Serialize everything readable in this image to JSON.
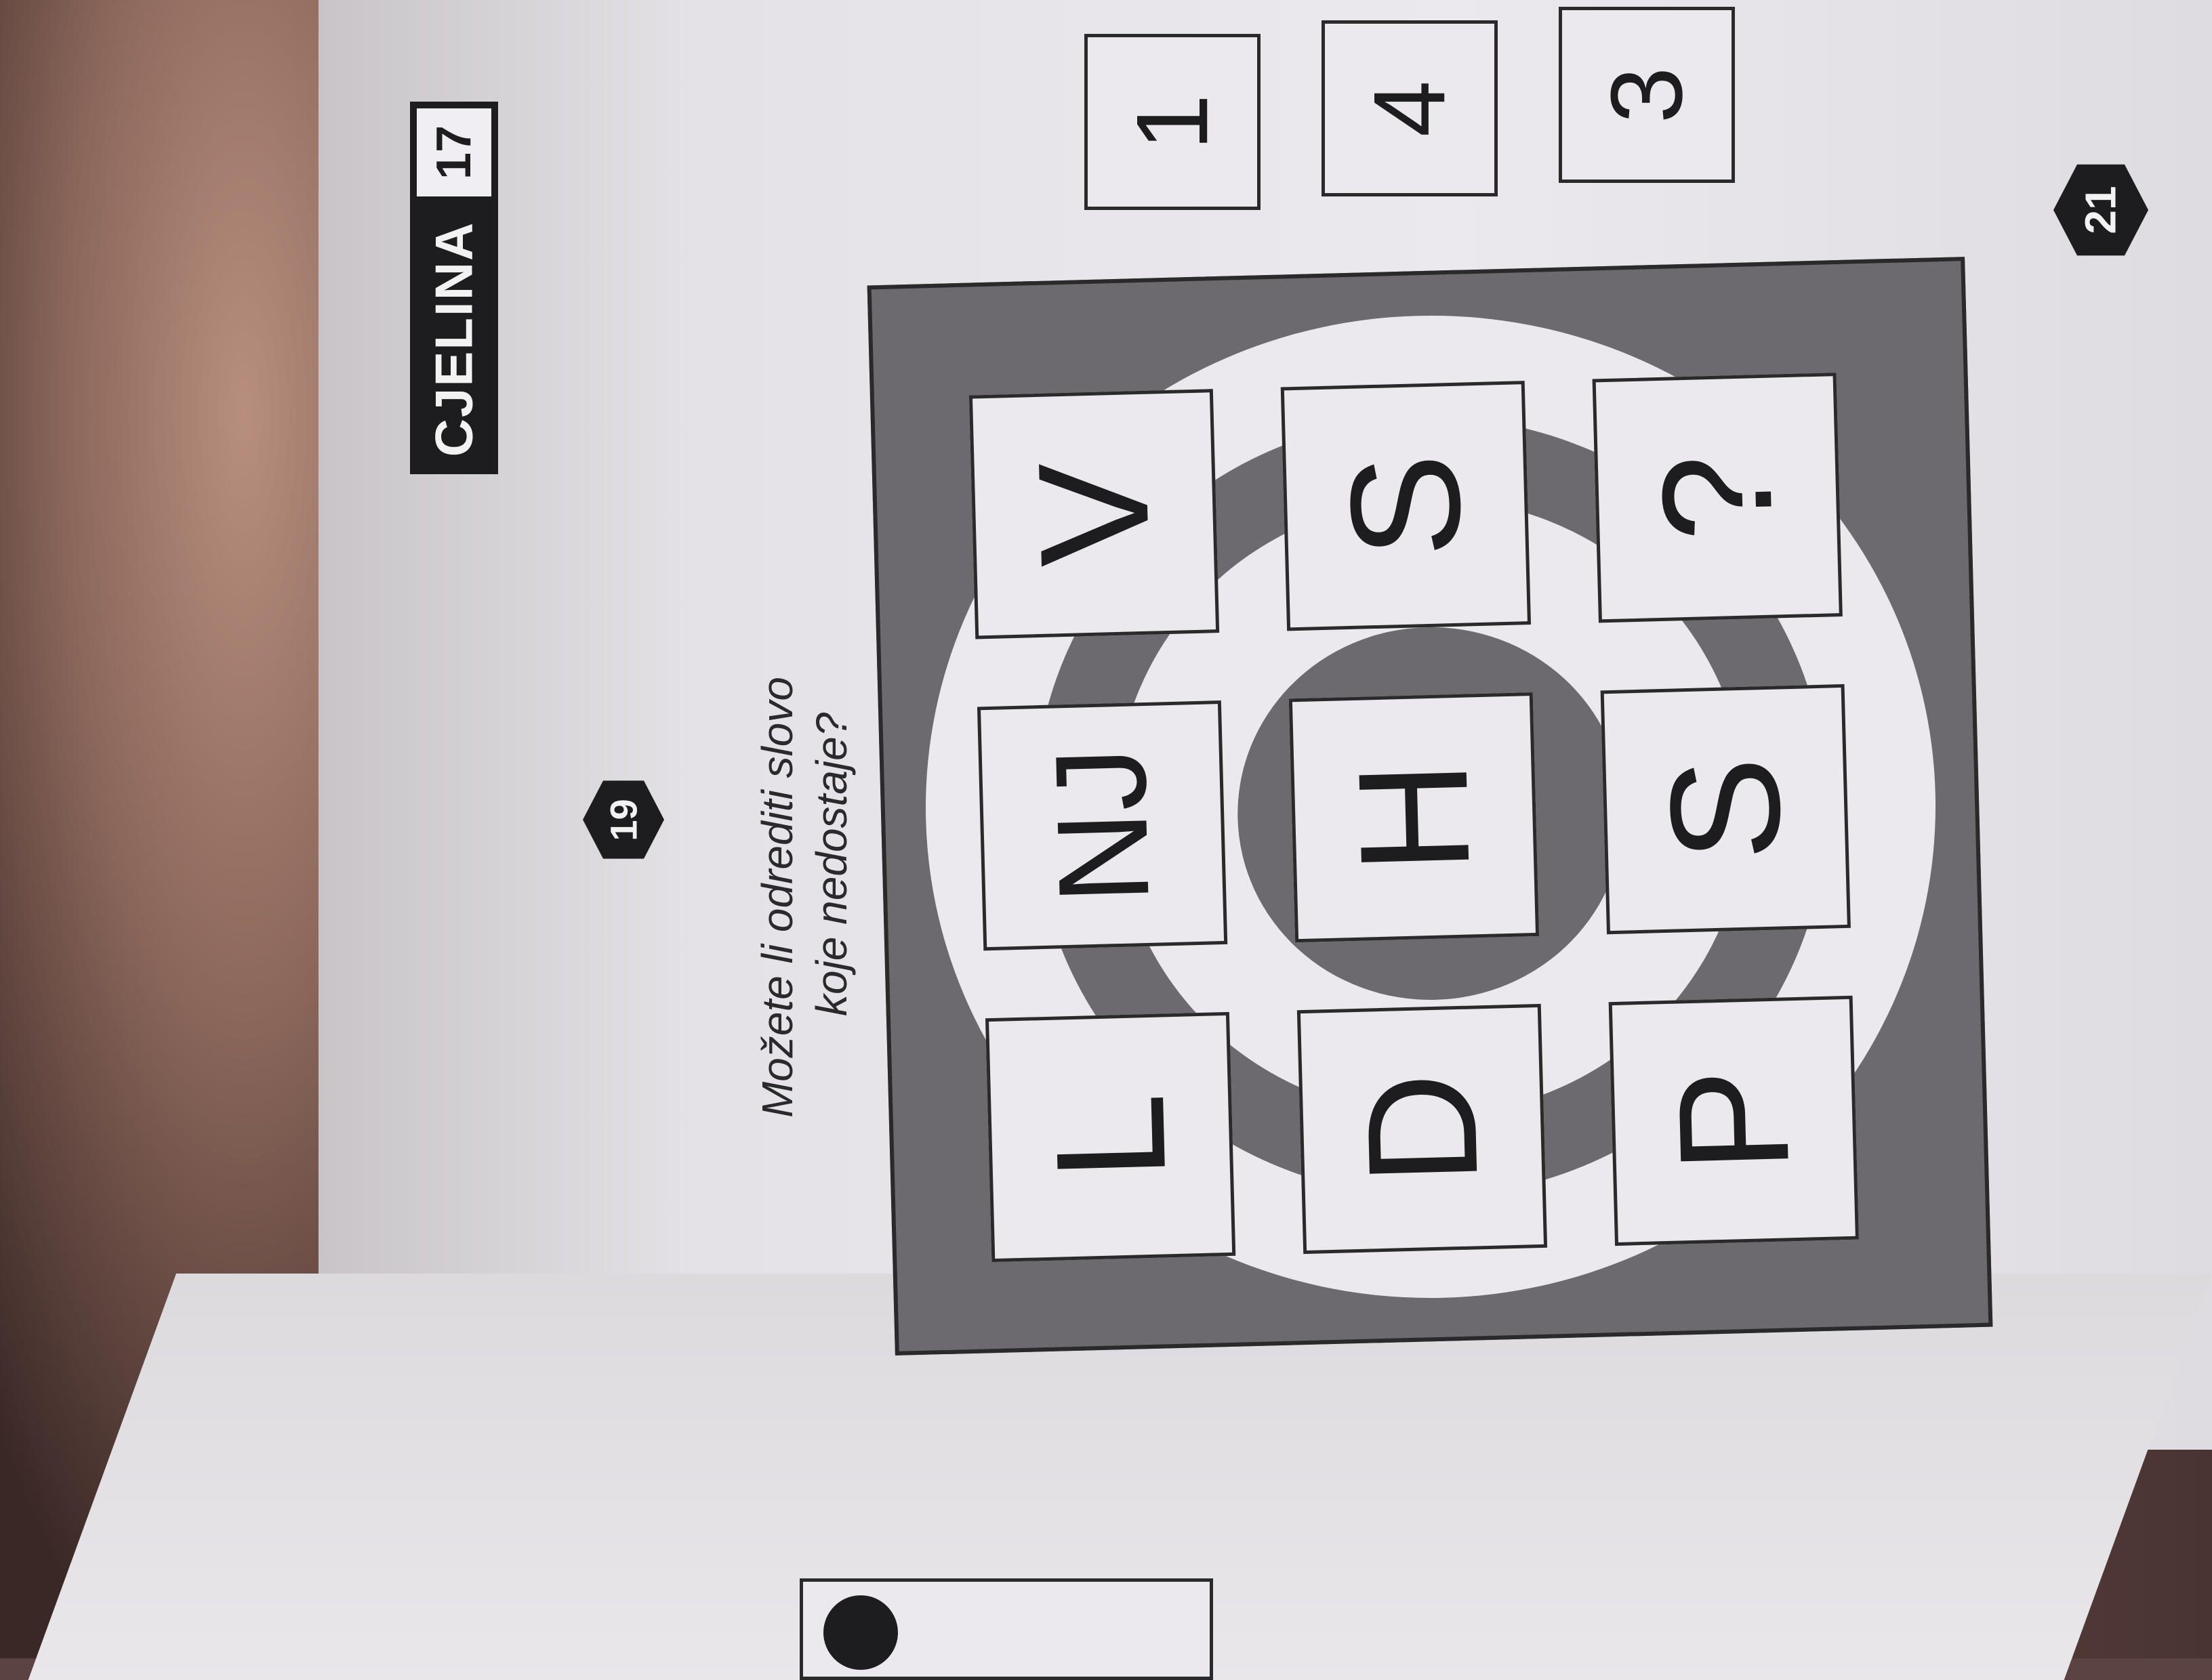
{
  "chapter": {
    "label": "CJELINA",
    "number": "17"
  },
  "problem": {
    "number": "19",
    "question_line1": "Možete li odrediti slovo",
    "question_line2": "koje nedostaje?"
  },
  "grid": {
    "rows": [
      [
        "L",
        "NJ",
        "V"
      ],
      [
        "D",
        "H",
        "S"
      ],
      [
        "P",
        "S",
        "?"
      ]
    ]
  },
  "answer_options": [
    "1",
    "4",
    "3"
  ],
  "page_number": "21",
  "colors": {
    "page": "#ebe9ed",
    "ink": "#1d1c1e",
    "frame": "#6c6a6e"
  }
}
